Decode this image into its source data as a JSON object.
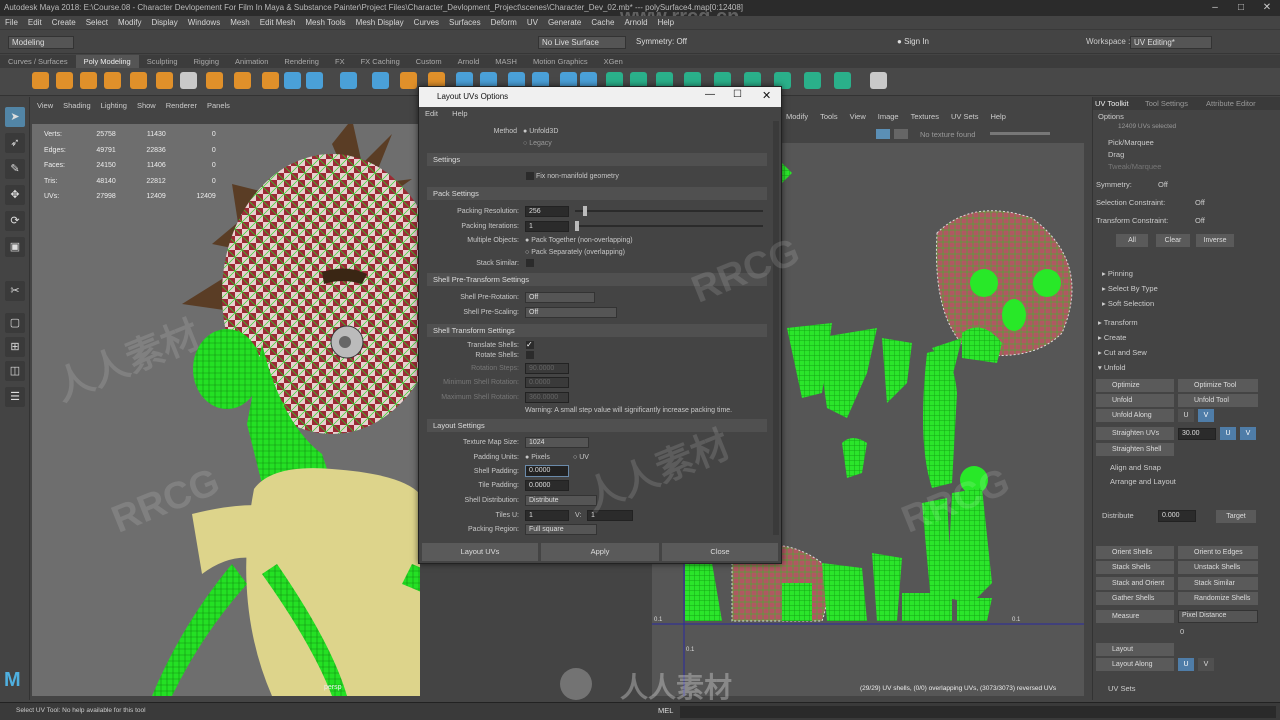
{
  "window": {
    "title": "Autodesk Maya 2018: E:\\Course.08 - Character Devlopement For Film In Maya & Substance Painter\\Project Files\\Character_Devlopment_Project\\scenes\\Character_Dev_02.mb*   ---   polySurface4.map[0:12408]",
    "watermark_url": "www.rrcg.cn"
  },
  "menubar": [
    "File",
    "Edit",
    "Create",
    "Select",
    "Modify",
    "Display",
    "Windows",
    "Mesh",
    "Edit Mesh",
    "Mesh Tools",
    "Mesh Display",
    "Curves",
    "Surfaces",
    "Deform",
    "UV",
    "Generate",
    "Cache",
    "Arnold",
    "Help"
  ],
  "statusline": {
    "mode": "Modeling",
    "live_surface": "No Live Surface",
    "symmetry": "Symmetry: Off",
    "sign_in": "Sign In",
    "workspace_label": "Workspace :",
    "workspace": "UV Editing*"
  },
  "shelf_tabs": [
    "Curves / Surfaces",
    "Poly Modeling",
    "Sculpting",
    "Rigging",
    "Animation",
    "Rendering",
    "FX",
    "FX Caching",
    "Custom",
    "Arnold",
    "MASH",
    "Motion Graphics",
    "XGen"
  ],
  "viewport": {
    "menu": [
      "View",
      "Shading",
      "Lighting",
      "Show",
      "Renderer",
      "Panels"
    ],
    "camera": "persp",
    "hud": [
      {
        "label": "Verts:",
        "a": "25758",
        "b": "11430",
        "c": "0"
      },
      {
        "label": "Edges:",
        "a": "49791",
        "b": "22836",
        "c": "0"
      },
      {
        "label": "Faces:",
        "a": "24150",
        "b": "11406",
        "c": "0"
      },
      {
        "label": "Tris:",
        "a": "48140",
        "b": "22812",
        "c": "0"
      },
      {
        "label": "UVs:",
        "a": "27998",
        "b": "12409",
        "c": "12409"
      }
    ]
  },
  "uv_editor": {
    "menu": [
      "Modify",
      "Tools",
      "View",
      "Image",
      "Textures",
      "UV Sets",
      "Help"
    ],
    "texture": "No texture found",
    "status": "(29/29) UV shells, (0/0) overlapping UVs, (3073/3073) reversed UVs",
    "axis_labels": [
      "0.1",
      "0.1",
      "0.1"
    ]
  },
  "dialog": {
    "title": "Layout UVs Options",
    "menu": [
      "Edit",
      "Help"
    ],
    "method_label": "Method",
    "method_options": [
      "Unfold3D",
      "Legacy"
    ],
    "settings_header": "Settings",
    "fix_nonmanifold": "Fix non-manifold geometry",
    "pack_header": "Pack Settings",
    "packing_resolution_label": "Packing Resolution:",
    "packing_resolution": "256",
    "packing_iterations_label": "Packing Iterations:",
    "packing_iterations": "1",
    "multiple_objects_label": "Multiple Objects:",
    "multiple_objects_opts": [
      "Pack Together (non-overlapping)",
      "Pack Separately (overlapping)"
    ],
    "stack_similar_label": "Stack Similar:",
    "pretransform_header": "Shell Pre-Transform Settings",
    "pre_rotation_label": "Shell Pre-Rotation:",
    "pre_rotation": "Off",
    "pre_scaling_label": "Shell Pre-Scaling:",
    "pre_scaling": "Off",
    "transform_header": "Shell Transform Settings",
    "translate_shells": "Translate Shells:",
    "rotate_shells": "Rotate Shells:",
    "rotation_steps_label": "Rotation Steps:",
    "rotation_steps": "90.0000",
    "min_rotation_label": "Minimum Shell Rotation:",
    "min_rotation": "0.0000",
    "max_rotation_label": "Maximum Shell Rotation:",
    "max_rotation": "360.0000",
    "warning": "Warning: A small step value will significantly increase packing time.",
    "layout_header": "Layout Settings",
    "texture_map_size_label": "Texture Map Size:",
    "texture_map_size": "1024",
    "padding_units_label": "Padding Units:",
    "padding_units_opts": [
      "Pixels",
      "UV"
    ],
    "shell_padding_label": "Shell Padding:",
    "shell_padding": "0.0000",
    "tile_padding_label": "Tile Padding:",
    "tile_padding": "0.0000",
    "shell_distribution_label": "Shell Distribution:",
    "shell_distribution": "Distribute",
    "tiles_u_label": "Tiles U:",
    "tiles_u": "1",
    "tiles_v_label": "V:",
    "tiles_v": "1",
    "packing_region_label": "Packing Region:",
    "packing_region": "Full square",
    "btn_layout": "Layout UVs",
    "btn_apply": "Apply",
    "btn_close": "Close"
  },
  "right_panel": {
    "tabs": [
      "UV Toolkit",
      "Tool Settings",
      "Attribute Editor"
    ],
    "options": "Options",
    "uvs_selected": "12409 UVs selected",
    "pick": "Pick/Marquee",
    "drag": "Drag",
    "tweak": "Tweak/Marquee",
    "symmetry_label": "Symmetry:",
    "symmetry": "Off",
    "sel_constraint_label": "Selection Constraint:",
    "sel_constraint": "Off",
    "xform_constraint_label": "Transform Constraint:",
    "xform_constraint": "Off",
    "all": "All",
    "clear": "Clear",
    "inverse": "Inverse",
    "sections_a": [
      "Pinning",
      "Select By Type",
      "Soft Selection"
    ],
    "sections_b": [
      "Transform",
      "Create",
      "Cut and Sew",
      "Unfold"
    ],
    "optimize": "Optimize",
    "optimize_tool": "Optimize Tool",
    "unfold": "Unfold",
    "unfold_tool": "Unfold Tool",
    "unfold_along": "Unfold Along",
    "u": "U",
    "v": "V",
    "straighten_uvs": "Straighten UVs",
    "straighten_val": "30.00",
    "straighten_shell": "Straighten Shell",
    "align_snap": "Align and Snap",
    "arrange": "Arrange and Layout",
    "distribute": "Distribute",
    "distribute_val": "0.000",
    "target": "Target",
    "orient_shells": "Orient Shells",
    "orient_edges": "Orient to Edges",
    "stack_shells": "Stack Shells",
    "unstack_shells": "Unstack Shells",
    "stack_orient": "Stack and Orient",
    "stack_similar": "Stack Similar",
    "gather_shells": "Gather Shells",
    "randomize_shells": "Randomize Shells",
    "measure": "Measure",
    "pixel_distance": "Pixel Distance",
    "measure_val": "0",
    "layout": "Layout",
    "layout_along": "Layout Along",
    "uv_sets": "UV Sets"
  },
  "statusbar": {
    "help": "Select UV Tool: No help available for this tool",
    "mel": "MEL"
  },
  "watermarks": [
    "RRCG",
    "人人素材"
  ]
}
